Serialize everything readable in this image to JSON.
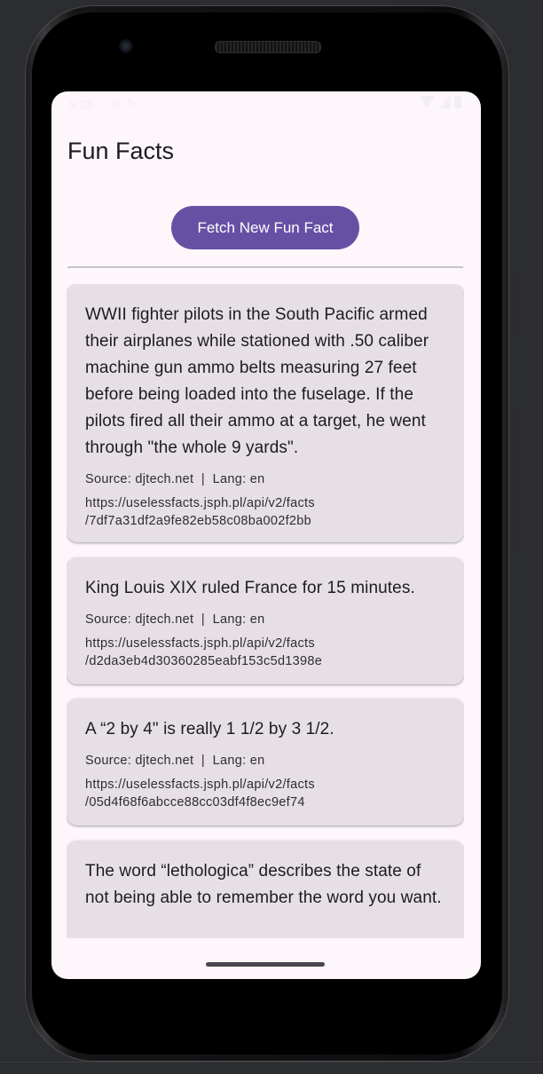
{
  "status_bar": {
    "time": "9:28",
    "left_icons": [
      "notification-icon",
      "sync-icon"
    ],
    "right_icons": [
      "wifi-icon",
      "signal-icon",
      "battery-icon"
    ]
  },
  "app": {
    "title": "Fun Facts",
    "fetch_button_label": "Fetch New Fun Fact"
  },
  "facts": [
    {
      "text": "WWII fighter pilots in the South Pacific armed their airplanes while stationed with .50 caliber machine gun ammo belts measuring 27 feet before being loaded into the fuselage. If the pilots fired all their ammo at a target, he went through \"the whole 9 yards\".",
      "meta": "Source: djtech.net  |  Lang: en",
      "link_line1": "https://uselessfacts.jsph.pl/api/v2/facts",
      "link_line2": "/7df7a31df2a9fe82eb58c08ba002f2bb"
    },
    {
      "text": "King Louis XIX ruled France for 15 minutes.",
      "meta": "Source: djtech.net  |  Lang: en",
      "link_line1": "https://uselessfacts.jsph.pl/api/v2/facts",
      "link_line2": "/d2da3eb4d30360285eabf153c5d1398e"
    },
    {
      "text": "A “2 by 4\" is really 1 1/2 by 3 1/2.",
      "meta": "Source: djtech.net  |  Lang: en",
      "link_line1": "https://uselessfacts.jsph.pl/api/v2/facts",
      "link_line2": "/05d4f68f6abcce88cc03df4f8ec9ef74"
    },
    {
      "text": "The word “lethologica” describes the state of not being able to remember the word you want.",
      "meta": "",
      "link_line1": "",
      "link_line2": ""
    }
  ],
  "colors": {
    "primary": "#6650a4",
    "surface": "#fdf7fc",
    "card": "#e6e0e6",
    "text": "#1d1b20"
  }
}
